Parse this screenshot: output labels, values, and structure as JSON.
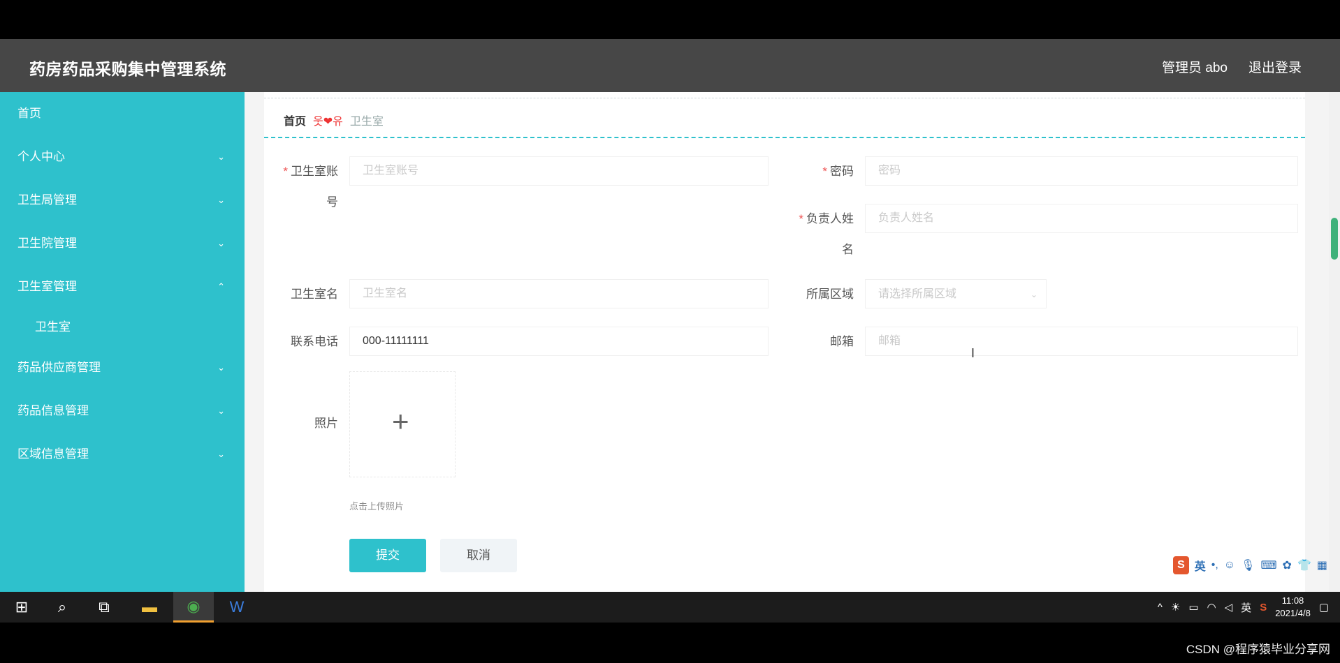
{
  "header": {
    "title": "药房药品采购集中管理系统",
    "user": "管理员 abo",
    "logout": "退出登录"
  },
  "sidebar": {
    "items": [
      {
        "label": "首页"
      },
      {
        "label": "个人中心",
        "chevron": "⌄"
      },
      {
        "label": "卫生局管理",
        "chevron": "⌄"
      },
      {
        "label": "卫生院管理",
        "chevron": "⌄"
      },
      {
        "label": "卫生室管理",
        "chevron": "⌃"
      },
      {
        "label": "药品供应商管理",
        "chevron": "⌄"
      },
      {
        "label": "药品信息管理",
        "chevron": "⌄"
      },
      {
        "label": "区域信息管理",
        "chevron": "⌄"
      }
    ],
    "subitem": "卫生室"
  },
  "breadcrumb": {
    "home": "首页",
    "deco": "웃❤유",
    "current": "卫生室"
  },
  "form": {
    "account": {
      "label_line1": "卫生室账",
      "label_line2": "号",
      "placeholder": "卫生室账号"
    },
    "password": {
      "label": "密码",
      "placeholder": "密码"
    },
    "manager": {
      "label_line1": "负责人姓",
      "label_line2": "名",
      "placeholder": "负责人姓名"
    },
    "clinic_name": {
      "label": "卫生室名",
      "placeholder": "卫生室名"
    },
    "region": {
      "label": "所属区域",
      "placeholder": "请选择所属区域"
    },
    "phone": {
      "label": "联系电话",
      "value": "000-11111111"
    },
    "email": {
      "label": "邮箱",
      "placeholder": "邮箱"
    },
    "photo": {
      "label": "照片",
      "tip": "点击上传照片"
    },
    "submit": "提交",
    "cancel": "取消"
  },
  "ime": {
    "lang": "英"
  },
  "taskbar": {
    "time": "11:08",
    "date": "2021/4/8",
    "ime_lang": "英"
  },
  "watermark": "CSDN @程序猿毕业分享网",
  "colors": {
    "accent": "#2ec1cc",
    "header": "#474747",
    "required": "#e55555"
  }
}
